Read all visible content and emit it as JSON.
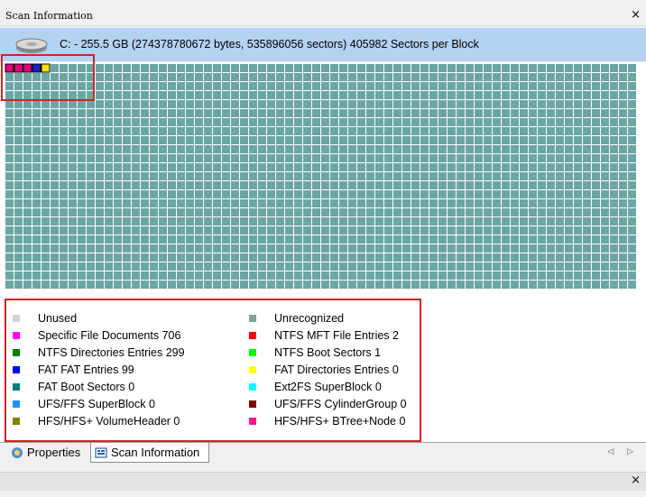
{
  "window": {
    "title": "Scan Information",
    "close_label": "×"
  },
  "disk": {
    "icon": "hard-disk-icon",
    "info": "C: - 255.5 GB (274378780672 bytes, 535896056 sectors)  405982 Sectors per Block"
  },
  "block_map": {
    "default_color": "#6aa6a4",
    "highlight_colors": [
      "#e6007a",
      "#e6007a",
      "#e6007a",
      "#1e1ec8",
      "#ffe000"
    ]
  },
  "legend": [
    {
      "label": "Unused",
      "color": "#d4d4d4"
    },
    {
      "label": "Specific File Documents 706",
      "color": "#ff00ff"
    },
    {
      "label": "NTFS Directories Entries 299",
      "color": "#008000"
    },
    {
      "label": "FAT FAT Entries 99",
      "color": "#0000ff"
    },
    {
      "label": "FAT Boot Sectors 0",
      "color": "#008080"
    },
    {
      "label": "UFS/FFS SuperBlock 0",
      "color": "#1e90ff"
    },
    {
      "label": "HFS/HFS+ VolumeHeader 0",
      "color": "#808000"
    },
    {
      "label": "Unrecognized",
      "color": "#7fa3a6"
    },
    {
      "label": "NTFS MFT File Entries 2",
      "color": "#ff0000"
    },
    {
      "label": "NTFS Boot Sectors 1",
      "color": "#00ff00"
    },
    {
      "label": "FAT Directories Entries 0",
      "color": "#ffff00"
    },
    {
      "label": "Ext2FS SuperBlock 0",
      "color": "#00ffff"
    },
    {
      "label": "UFS/FFS CylinderGroup 0",
      "color": "#800000"
    },
    {
      "label": "HFS/HFS+ BTree+Node 0",
      "color": "#ff1493"
    }
  ],
  "tabs": [
    {
      "label": "Properties",
      "icon": "properties-icon"
    },
    {
      "label": "Scan Information",
      "icon": "scan-information-icon"
    }
  ],
  "tab_scroll": "◁ ▷",
  "bottom_close": "×"
}
